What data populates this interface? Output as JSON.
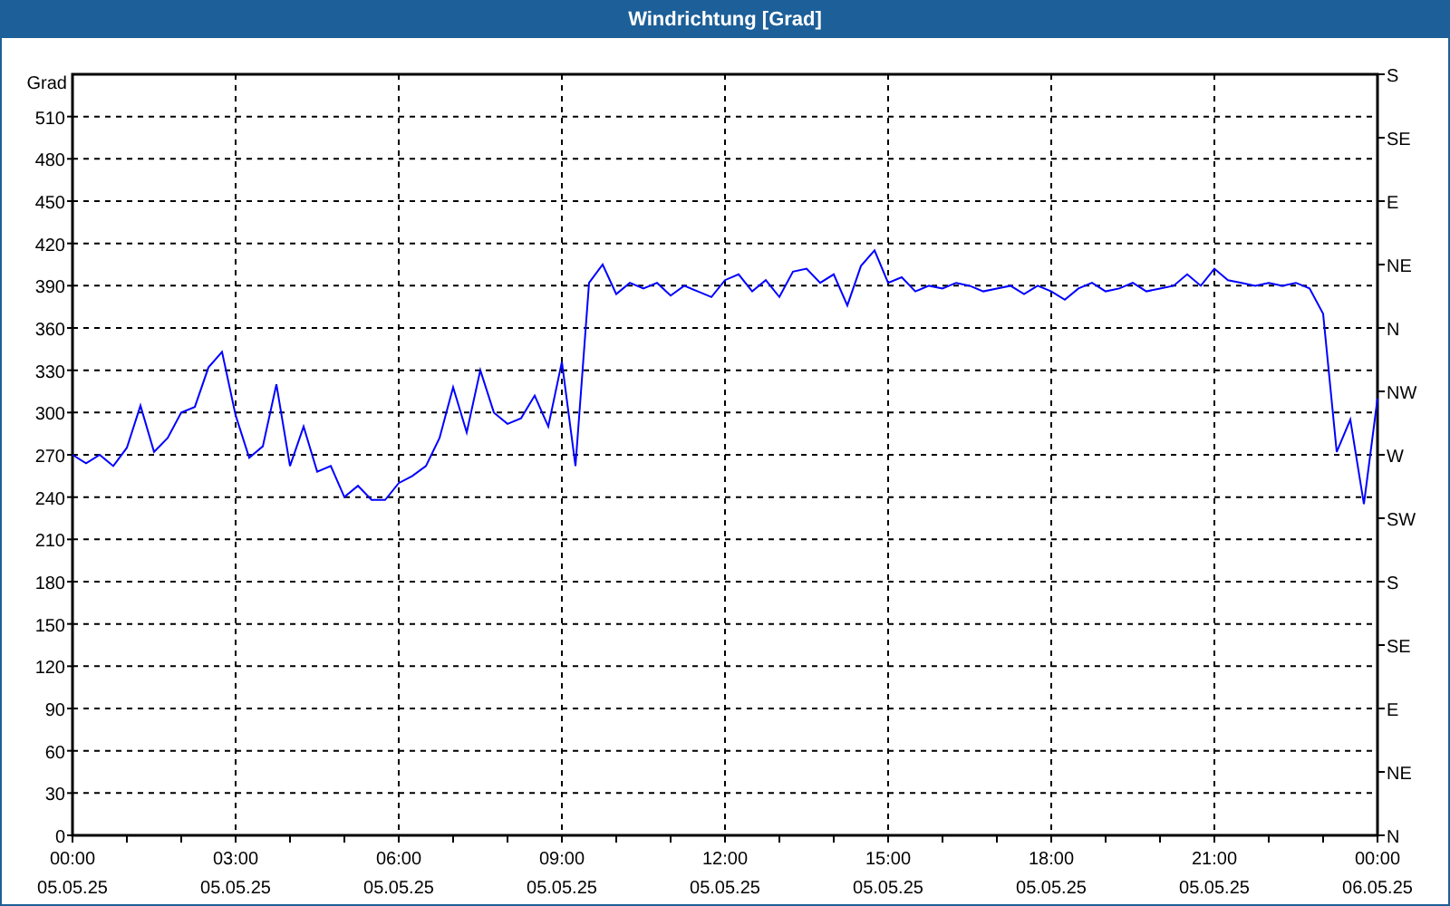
{
  "window": {
    "title": "Windrichtung [Grad]"
  },
  "chart_data": {
    "type": "line",
    "grid": true,
    "ylabel": "Grad",
    "ylim": [
      0,
      540
    ],
    "yticks": [
      0,
      30,
      60,
      90,
      120,
      150,
      180,
      210,
      240,
      270,
      300,
      330,
      360,
      390,
      420,
      450,
      480,
      510
    ],
    "categories": [
      "00:00\n05.05.25",
      null,
      null,
      null,
      null,
      null,
      null,
      null,
      null,
      null,
      null,
      null,
      "03:00\n05.05.25",
      null,
      null,
      null,
      null,
      null,
      null,
      null,
      null,
      null,
      null,
      null,
      "06:00\n05.05.25",
      null,
      null,
      null,
      null,
      null,
      null,
      null,
      null,
      null,
      null,
      null,
      "09:00\n05.05.25",
      null,
      null,
      null,
      null,
      null,
      null,
      null,
      null,
      null,
      null,
      null,
      "12:00\n05.05.25",
      null,
      null,
      null,
      null,
      null,
      null,
      null,
      null,
      null,
      null,
      null,
      "15:00\n05.05.25",
      null,
      null,
      null,
      null,
      null,
      null,
      null,
      null,
      null,
      null,
      null,
      "18:00\n05.05.25",
      null,
      null,
      null,
      null,
      null,
      null,
      null,
      null,
      null,
      null,
      null,
      "21:00\n05.05.25",
      null,
      null,
      null,
      null,
      null,
      null,
      null,
      null,
      null,
      null,
      null,
      "00:00\n06.05.25"
    ],
    "series": [
      {
        "color": "#0000ff",
        "values": [
          270,
          264,
          270,
          262,
          275,
          305,
          272,
          282,
          300,
          304,
          332,
          343,
          298,
          268,
          276,
          320,
          262,
          290,
          258,
          262,
          240,
          248,
          238,
          238,
          250,
          255,
          262,
          282,
          318,
          286,
          330,
          300,
          292,
          296,
          312,
          290,
          336,
          262,
          392,
          405,
          384,
          392,
          388,
          392,
          383,
          390,
          386,
          382,
          394,
          398,
          386,
          394,
          382,
          400,
          402,
          392,
          398,
          376,
          404,
          415,
          392,
          396,
          386,
          390,
          388,
          392,
          390,
          386,
          388,
          390,
          384,
          390,
          386,
          380,
          388,
          392,
          386,
          388,
          392,
          386,
          388,
          390,
          398,
          390,
          402,
          394,
          392,
          390,
          392,
          390,
          392,
          388,
          370,
          272,
          295,
          235,
          310
        ]
      }
    ]
  },
  "compass_labels": [
    "S",
    "SE",
    "E",
    "NE",
    "N",
    "NW",
    "W",
    "SW",
    "S",
    "SE",
    "E",
    "NE",
    "N"
  ]
}
